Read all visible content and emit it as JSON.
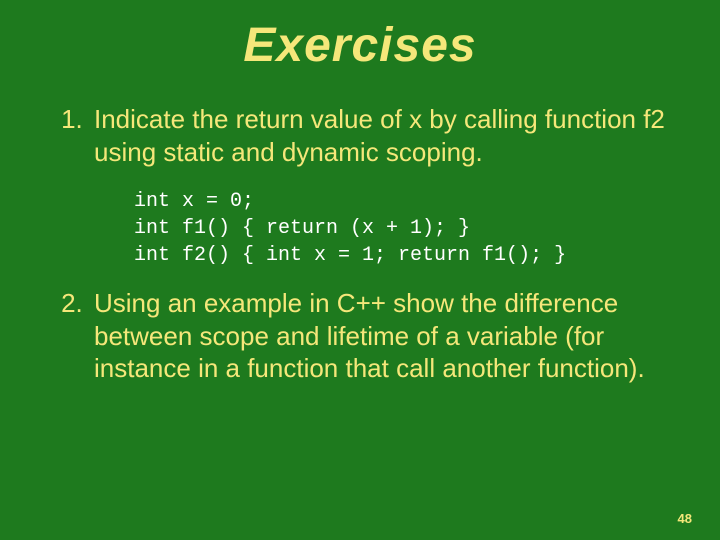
{
  "title": "Exercises",
  "items": [
    {
      "text": "Indicate the return value of x by calling function f2 using static and dynamic scoping.",
      "code": "int x = 0;\nint f1() { return (x + 1); }\nint f2() { int x = 1; return f1(); }"
    },
    {
      "text": "Using an example in C++ show the difference between scope and lifetime of a variable (for instance in a function that call another function)."
    }
  ],
  "page_number": "48"
}
